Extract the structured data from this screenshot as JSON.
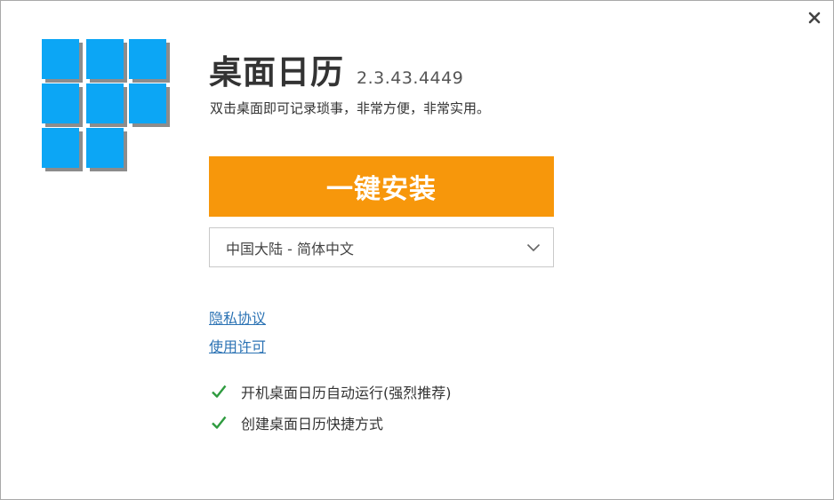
{
  "window": {
    "close_glyph": "✕"
  },
  "app": {
    "title": "桌面日历",
    "version": "2.3.43.4449",
    "description": "双击桌面即可记录琐事，非常方便，非常实用。",
    "logo_icon": "calendar-grid-logo-icon",
    "logo_color": "#0ca6f5"
  },
  "install": {
    "label": "一键安装",
    "color": "#f7970b"
  },
  "language": {
    "selected": "中国大陆 - 简体中文"
  },
  "links": {
    "privacy": "隐私协议",
    "license": "使用许可",
    "color": "#2c73b4"
  },
  "options": {
    "autostart": {
      "label": "开机桌面日历自动运行(强烈推荐)",
      "checked": true
    },
    "shortcut": {
      "label": "创建桌面日历快捷方式",
      "checked": true
    },
    "check_color": "#2e9b3f"
  }
}
